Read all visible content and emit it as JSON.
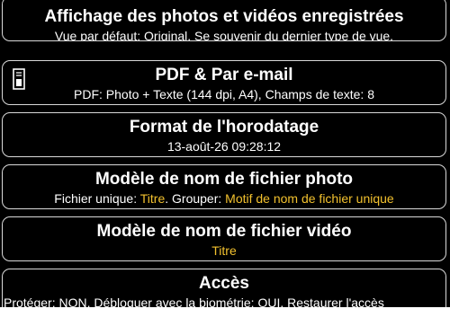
{
  "settings": [
    {
      "title": "Affichage des photos et vidéos enregistrées",
      "subtitle": "Vue par défaut: Original. Se souvenir du dernier type de vue."
    },
    {
      "title": "PDF & Par e-mail",
      "subtitle": "PDF: Photo + Texte (144 dpi, A4), Champs de texte: 8",
      "icon": "document-icon"
    },
    {
      "title": "Format de l'horodatage",
      "subtitle": "13-août-26 09:28:12"
    },
    {
      "title": "Modèle de nom de fichier photo",
      "subtitle_parts": [
        "Fichier unique: ",
        "Titre",
        ". Grouper: ",
        "Motif de nom de fichier unique"
      ]
    },
    {
      "title": "Modèle de nom de fichier vidéo",
      "subtitle": "Titre"
    },
    {
      "title": "Accès",
      "subtitle": "Protéger: NON. Débloquer avec la biométrie: OUI. Restaurer l'accès"
    }
  ],
  "colors": {
    "background": "#000000",
    "text": "#ffffff",
    "accent": "#f2c12e",
    "card_border": "#d9d9d9"
  }
}
